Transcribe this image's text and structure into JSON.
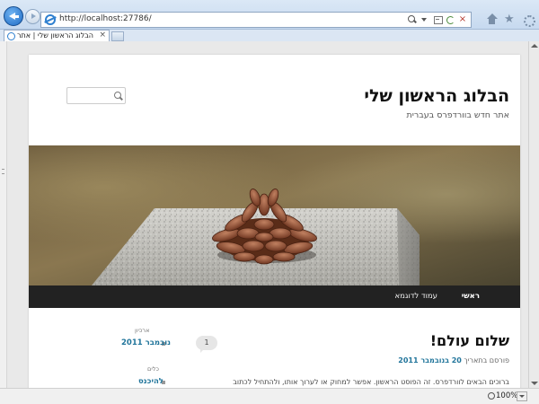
{
  "browser": {
    "url": "http://localhost:27786/",
    "tab_title": "הבלוג הראשון שלי | אתר",
    "tab_close": "×",
    "stop_glyph": "×",
    "star_glyph": "★",
    "zoom": "100%",
    "icons": [
      "back-icon",
      "forward-icon",
      "ie-icon",
      "search-icon",
      "dropdown-icon",
      "compat-view-icon",
      "refresh-icon",
      "stop-icon",
      "home-icon",
      "star-icon",
      "gear-icon",
      "zoom-icon"
    ]
  },
  "site": {
    "title": "הבלוג הראשון שלי",
    "tagline": "אתר חדש בוורדפרס בעברית",
    "search_placeholder": ""
  },
  "nav": {
    "home": "ראשי",
    "sample_page": "עמוד לדוגמא"
  },
  "post": {
    "title": "שלום עולם!",
    "comments_count": "1",
    "meta_prefix": "פורסם בתאריך",
    "date": "20 בנובמבר 2011",
    "excerpt": "ברוכים הבאים לוורדפרס. זה הפוסט הראשון. אפשר למחוק או לערוך אותו, ולהתחיל לכתוב"
  },
  "sidebar": {
    "archives_title": "ארכיון",
    "archive_link": "נובמבר 2011",
    "tags_title": "כלים",
    "tags_link": "להיכנס"
  },
  "colors": {
    "link": "#21759b",
    "nav_bg": "#222222",
    "chrome_blue": "#1f6bc4"
  }
}
